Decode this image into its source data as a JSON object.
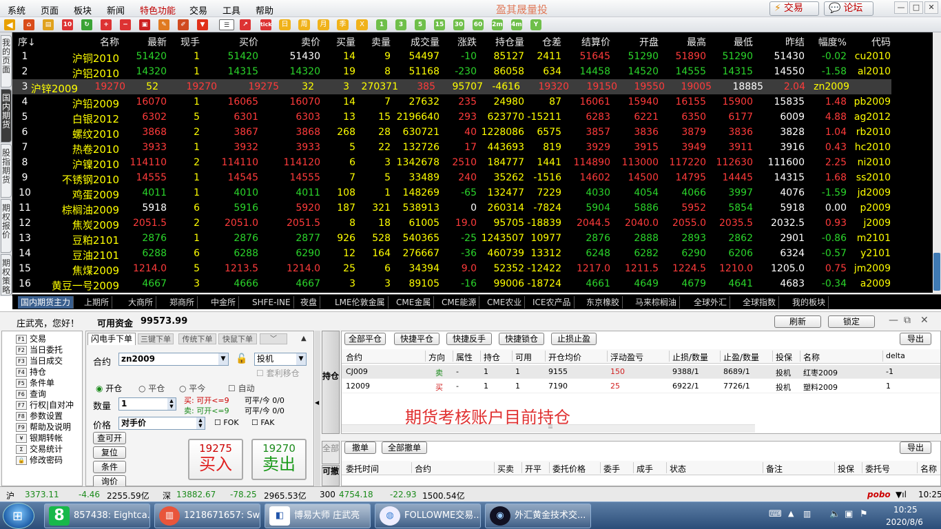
{
  "menu": {
    "items": [
      "系统",
      "页面",
      "板块",
      "新闻",
      "特色功能",
      "交易",
      "工具",
      "帮助"
    ],
    "app_title": "盈其晟量投",
    "trade_btn": "交易",
    "forum_btn": "论坛",
    "win_min": "—",
    "win_max": "□",
    "win_close": "✕"
  },
  "toolbar": {
    "period_labels": [
      "日",
      "周",
      "月",
      "季",
      "X"
    ],
    "minute_labels": [
      "1",
      "3",
      "5",
      "15",
      "30",
      "60",
      "2m",
      "4m",
      "Y"
    ],
    "tick": "tick"
  },
  "left_tabs": [
    "我的页面",
    "国内期货",
    "股指期货",
    "期权报价",
    "期权策略"
  ],
  "quote": {
    "headers": [
      "序↓",
      "名称",
      "最新",
      "现手",
      "买价",
      "卖价",
      "买量",
      "卖量",
      "成交量",
      "涨跌",
      "持仓量",
      "仓差",
      "结算价",
      "开盘",
      "最高",
      "最低",
      "昨结",
      "幅度%",
      "代码"
    ],
    "rows": [
      [
        "1",
        "沪铜2010",
        "51420",
        "1",
        "51420",
        "51430",
        "14",
        "9",
        "54497",
        "-10",
        "85127",
        "2411",
        "51645",
        "51290",
        "51890",
        "51290",
        "51430",
        "-0.02",
        "cu2010"
      ],
      [
        "2",
        "沪铝2010",
        "14320",
        "1",
        "14315",
        "14320",
        "19",
        "8",
        "51168",
        "-230",
        "86058",
        "634",
        "14458",
        "14520",
        "14555",
        "14315",
        "14550",
        "-1.58",
        "al2010"
      ],
      [
        "3",
        "沪锌2009",
        "19270",
        "52",
        "19270",
        "19275",
        "32",
        "3",
        "270371",
        "385",
        "95707",
        "-4616",
        "19320",
        "19150",
        "19550",
        "19005",
        "18885",
        "2.04",
        "zn2009"
      ],
      [
        "4",
        "沪铅2009",
        "16070",
        "1",
        "16065",
        "16070",
        "14",
        "7",
        "27632",
        "235",
        "24980",
        "87",
        "16061",
        "15940",
        "16155",
        "15900",
        "15835",
        "1.48",
        "pb2009"
      ],
      [
        "5",
        "白银2012",
        "6302",
        "5",
        "6301",
        "6303",
        "13",
        "15",
        "2196640",
        "293",
        "623770",
        "-15211",
        "6283",
        "6221",
        "6350",
        "6177",
        "6009",
        "4.88",
        "ag2012"
      ],
      [
        "6",
        "螺纹2010",
        "3868",
        "2",
        "3867",
        "3868",
        "268",
        "28",
        "630721",
        "40",
        "1228086",
        "6575",
        "3857",
        "3836",
        "3879",
        "3836",
        "3828",
        "1.04",
        "rb2010"
      ],
      [
        "7",
        "热卷2010",
        "3933",
        "1",
        "3932",
        "3933",
        "5",
        "22",
        "132726",
        "17",
        "443693",
        "819",
        "3929",
        "3915",
        "3949",
        "3911",
        "3916",
        "0.43",
        "hc2010"
      ],
      [
        "8",
        "沪镍2010",
        "114110",
        "2",
        "114110",
        "114120",
        "6",
        "3",
        "1342678",
        "2510",
        "184777",
        "1441",
        "114890",
        "113000",
        "117220",
        "112630",
        "111600",
        "2.25",
        "ni2010"
      ],
      [
        "9",
        "不锈钢2010",
        "14555",
        "1",
        "14545",
        "14555",
        "7",
        "5",
        "33489",
        "240",
        "35262",
        "-1516",
        "14602",
        "14500",
        "14795",
        "14445",
        "14315",
        "1.68",
        "ss2010"
      ],
      [
        "10",
        "鸡蛋2009",
        "4011",
        "1",
        "4010",
        "4011",
        "108",
        "1",
        "148269",
        "-65",
        "132477",
        "7229",
        "4030",
        "4054",
        "4066",
        "3997",
        "4076",
        "-1.59",
        "jd2009"
      ],
      [
        "11",
        "棕榈油2009",
        "5918",
        "6",
        "5916",
        "5920",
        "187",
        "321",
        "538913",
        "0",
        "260314",
        "-7824",
        "5904",
        "5886",
        "5952",
        "5854",
        "5918",
        "0.00",
        "p2009"
      ],
      [
        "12",
        "焦炭2009",
        "2051.5",
        "2",
        "2051.0",
        "2051.5",
        "8",
        "18",
        "61005",
        "19.0",
        "95705",
        "-18839",
        "2044.5",
        "2040.0",
        "2055.0",
        "2035.5",
        "2032.5",
        "0.93",
        "j2009"
      ],
      [
        "13",
        "豆粕2101",
        "2876",
        "1",
        "2876",
        "2877",
        "926",
        "528",
        "540365",
        "-25",
        "1243507",
        "10977",
        "2876",
        "2888",
        "2893",
        "2862",
        "2901",
        "-0.86",
        "m2101"
      ],
      [
        "14",
        "豆油2101",
        "6288",
        "6",
        "6288",
        "6290",
        "12",
        "164",
        "276667",
        "-36",
        "460739",
        "13312",
        "6248",
        "6282",
        "6290",
        "6206",
        "6324",
        "-0.57",
        "y2101"
      ],
      [
        "15",
        "焦煤2009",
        "1214.0",
        "5",
        "1213.5",
        "1214.0",
        "25",
        "6",
        "34394",
        "9.0",
        "52352",
        "-12422",
        "1217.0",
        "1211.5",
        "1224.5",
        "1210.0",
        "1205.0",
        "0.75",
        "jm2009"
      ],
      [
        "16",
        "黄豆一号2009",
        "4667",
        "3",
        "4666",
        "4667",
        "3",
        "3",
        "89105",
        "-16",
        "99006",
        "-18724",
        "4661",
        "4649",
        "4679",
        "4641",
        "4683",
        "-0.34",
        "a2009"
      ]
    ],
    "colors": [
      [
        "w",
        "y",
        "g",
        "y",
        "g",
        "w",
        "y",
        "y",
        "y",
        "g",
        "y",
        "y",
        "r",
        "g",
        "r",
        "g",
        "w",
        "g",
        "y"
      ],
      [
        "w",
        "y",
        "g",
        "y",
        "g",
        "g",
        "y",
        "y",
        "y",
        "g",
        "y",
        "y",
        "g",
        "g",
        "g",
        "g",
        "w",
        "g",
        "y"
      ],
      [
        "w",
        "y",
        "r",
        "y",
        "r",
        "r",
        "y",
        "y",
        "y",
        "r",
        "y",
        "y",
        "r",
        "r",
        "r",
        "r",
        "w",
        "r",
        "y"
      ],
      [
        "w",
        "y",
        "r",
        "y",
        "r",
        "r",
        "y",
        "y",
        "y",
        "r",
        "y",
        "y",
        "r",
        "r",
        "r",
        "r",
        "w",
        "r",
        "y"
      ],
      [
        "w",
        "y",
        "r",
        "y",
        "r",
        "r",
        "y",
        "y",
        "y",
        "r",
        "y",
        "y",
        "r",
        "r",
        "r",
        "r",
        "w",
        "r",
        "y"
      ],
      [
        "w",
        "y",
        "r",
        "y",
        "r",
        "r",
        "y",
        "y",
        "y",
        "r",
        "y",
        "y",
        "r",
        "r",
        "r",
        "r",
        "w",
        "r",
        "y"
      ],
      [
        "w",
        "y",
        "r",
        "y",
        "r",
        "r",
        "y",
        "y",
        "y",
        "r",
        "y",
        "y",
        "r",
        "r",
        "r",
        "r",
        "w",
        "r",
        "y"
      ],
      [
        "w",
        "y",
        "r",
        "y",
        "r",
        "r",
        "y",
        "y",
        "y",
        "r",
        "y",
        "y",
        "r",
        "r",
        "r",
        "r",
        "w",
        "r",
        "y"
      ],
      [
        "w",
        "y",
        "r",
        "y",
        "r",
        "r",
        "y",
        "y",
        "y",
        "r",
        "y",
        "y",
        "r",
        "r",
        "r",
        "r",
        "w",
        "r",
        "y"
      ],
      [
        "w",
        "y",
        "g",
        "y",
        "g",
        "g",
        "y",
        "y",
        "y",
        "g",
        "y",
        "y",
        "g",
        "g",
        "g",
        "g",
        "w",
        "g",
        "y"
      ],
      [
        "w",
        "y",
        "w",
        "y",
        "g",
        "r",
        "y",
        "y",
        "y",
        "w",
        "y",
        "y",
        "g",
        "g",
        "r",
        "g",
        "w",
        "w",
        "y"
      ],
      [
        "w",
        "y",
        "r",
        "y",
        "r",
        "r",
        "y",
        "y",
        "y",
        "r",
        "y",
        "y",
        "r",
        "r",
        "r",
        "r",
        "w",
        "r",
        "y"
      ],
      [
        "w",
        "y",
        "g",
        "y",
        "g",
        "g",
        "y",
        "y",
        "y",
        "g",
        "y",
        "y",
        "g",
        "g",
        "g",
        "g",
        "w",
        "g",
        "y"
      ],
      [
        "w",
        "y",
        "g",
        "y",
        "g",
        "g",
        "y",
        "y",
        "y",
        "g",
        "y",
        "y",
        "g",
        "g",
        "g",
        "g",
        "w",
        "g",
        "y"
      ],
      [
        "w",
        "y",
        "r",
        "y",
        "r",
        "r",
        "y",
        "y",
        "y",
        "r",
        "y",
        "y",
        "r",
        "r",
        "r",
        "r",
        "w",
        "r",
        "y"
      ],
      [
        "w",
        "y",
        "g",
        "y",
        "g",
        "g",
        "y",
        "y",
        "y",
        "g",
        "y",
        "y",
        "g",
        "g",
        "g",
        "g",
        "w",
        "g",
        "y"
      ]
    ]
  },
  "bottom_tabs": [
    "国内期货主力",
    "上期所",
    "大商所",
    "郑商所",
    "中金所",
    "SHFE-INE",
    "夜盘",
    "LME伦敦金属",
    "CME金属",
    "CME能源",
    "CME农业",
    "ICE农产品",
    "东京橡胶",
    "马来棕榈油",
    "全球外汇",
    "全球指数",
    "我的板块"
  ],
  "account": {
    "greeting": "庄武亮，您好！",
    "funds_label": "可用资金",
    "funds_value": "99573.99",
    "refresh": "刷新",
    "lock": "锁定"
  },
  "side_menu": [
    [
      "F1",
      "交易"
    ],
    [
      "F2",
      "当日委托"
    ],
    [
      "F3",
      "当日成交"
    ],
    [
      "F4",
      "持仓"
    ],
    [
      "F5",
      "条件单"
    ],
    [
      "F6",
      "查询"
    ],
    [
      "F7",
      "行权|自对冲"
    ],
    [
      "F8",
      "参数设置"
    ],
    [
      "F9",
      "帮助及说明"
    ],
    [
      "¥",
      "银期转帐"
    ],
    [
      "Σ",
      "交易统计"
    ],
    [
      "🔒",
      "修改密码"
    ]
  ],
  "order": {
    "tabs": [
      "闪电手下单",
      "三键下单",
      "传统下单",
      "快鼠下单"
    ],
    "contract_label": "合约",
    "contract_value": "zn2009",
    "type_value": "投机",
    "hedge_label": "套利移仓",
    "open": "开仓",
    "close": "平仓",
    "close_today": "平今",
    "auto": "自动",
    "qty_label": "数量",
    "qty_value": "1",
    "buy_info1": "买: 可开<=9",
    "buy_info2": "可平/今 0/0",
    "sell_info1": "卖: 可开<=9",
    "sell_info2": "可平/今 0/0",
    "price_label": "价格",
    "price_value": "对手价",
    "fok": "FOK",
    "fak": "FAK",
    "btn_query": "查可开",
    "btn_reset": "复位",
    "btn_cond": "条件",
    "btn_ask": "询价",
    "buy_price": "19275",
    "buy_label": "买入",
    "sell_price": "19270",
    "sell_label": "卖出"
  },
  "positions": {
    "side_tab": "持仓",
    "buttons": [
      "全部平仓",
      "快捷平仓",
      "快捷反手",
      "快捷锁仓",
      "止损止盈"
    ],
    "export": "导出",
    "headers": [
      "合约",
      "方向",
      "属性",
      "持仓",
      "可用",
      "开仓均价",
      "浮动盈亏",
      "止损/数量",
      "止盈/数量",
      "投保",
      "名称",
      "delta"
    ],
    "rows": [
      [
        "CJ009",
        "卖",
        "-",
        "1",
        "1",
        "9155",
        "150",
        "9388/1",
        "8689/1",
        "投机",
        "红枣2009",
        "-1"
      ],
      [
        "12009",
        "买",
        "-",
        "1",
        "1",
        "7190",
        "25",
        "6922/1",
        "7726/1",
        "投机",
        "塑料2009",
        "1"
      ]
    ],
    "overlay": "期货考核账户目前持仓"
  },
  "orders": {
    "side_tab1": "全部",
    "side_tab2": "可撤",
    "buttons": [
      "撤单",
      "全部撤单"
    ],
    "export": "导出",
    "headers": [
      "委托时间",
      "合约",
      "买卖",
      "开平",
      "委托价格",
      "委手",
      "成手",
      "状态",
      "备注",
      "投保",
      "委托号",
      "名称"
    ]
  },
  "status": {
    "sh_label": "沪",
    "sh_val": "3373.11",
    "sh_chg": "-4.46",
    "sh_amt": "2255.59亿",
    "sz_label": "深",
    "sz_val": "13882.67",
    "sz_chg": "-78.25",
    "sz_amt": "2965.53亿",
    "hs_label": "300",
    "hs_val": "4754.18",
    "hs_chg": "-22.93",
    "hs_amt": "1500.54亿",
    "brand": "pobo",
    "time": "10:25"
  },
  "taskbar": {
    "tasks": [
      "857438: Eightca...",
      "1218671657: Sw...",
      "博易大师 庄武亮",
      "FOLLOWME交易...",
      "外汇黄金技术交..."
    ],
    "clock_time": "10:25",
    "clock_date": "2020/8/6"
  }
}
